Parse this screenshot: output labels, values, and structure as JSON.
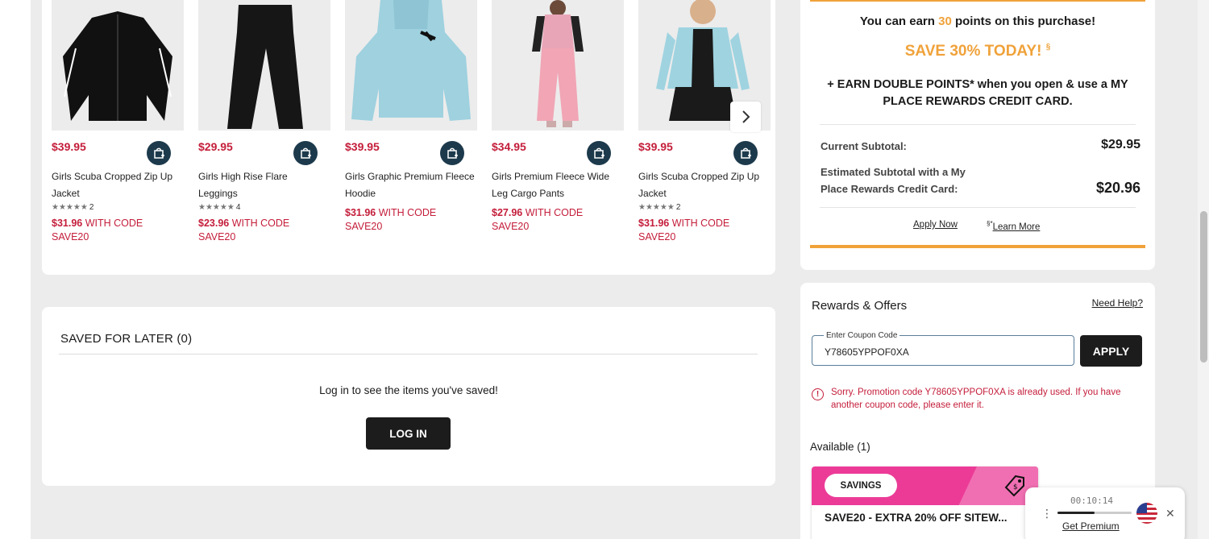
{
  "products": [
    {
      "price": "$39.95",
      "name": "Girls Scuba Cropped Zip Up Jacket",
      "rating_count": "2",
      "rating": 5,
      "promo_price": "$31.96",
      "promo_text": "WITH CODE SAVE20",
      "image": "black-jacket"
    },
    {
      "price": "$29.95",
      "name": "Girls High Rise Flare Leggings",
      "rating_count": "4",
      "rating": 5,
      "promo_price": "$23.96",
      "promo_text": "WITH CODE SAVE20",
      "image": "black-leggings"
    },
    {
      "price": "$39.95",
      "name": "Girls Graphic Premium Fleece Hoodie",
      "rating_count": "",
      "promo_price": "$31.96",
      "promo_text": "WITH CODE SAVE20",
      "image": "blue-hoodie"
    },
    {
      "price": "$34.95",
      "name": "Girls Premium Fleece Wide Leg Cargo Pants",
      "rating_count": "",
      "promo_price": "$27.96",
      "promo_text": "WITH CODE SAVE20",
      "image": "pink-cargo-pants"
    },
    {
      "price": "$39.95",
      "name": "Girls Scuba Cropped Zip Up Jacket",
      "rating_count": "2",
      "rating": 5,
      "promo_price": "$31.96",
      "promo_text": "WITH CODE SAVE20",
      "image": "blue-jacket"
    }
  ],
  "saved": {
    "title": "SAVED FOR LATER (0)",
    "message": "Log in to see the items you've saved!",
    "login_label": "LOG IN"
  },
  "summary": {
    "earn_prefix": "You can earn",
    "earn_points": "30",
    "earn_suffix": "points on this purchase!",
    "save_today": "SAVE 30% TODAY!",
    "save_mark": "§",
    "double_points": "+ EARN DOUBLE POINTS* when you open & use a MY PLACE REWARDS CREDIT CARD.",
    "current_label": "Current Subtotal:",
    "current_value": "$29.95",
    "estimated_label": "Estimated Subtotal with a My Place Rewards Credit Card:",
    "estimated_value": "$20.96",
    "apply_now": "Apply Now",
    "learn_mark": "§*",
    "learn_more": "Learn More"
  },
  "rewards": {
    "title": "Rewards & Offers",
    "need_help": "Need Help?",
    "coupon_label": "Enter Coupon Code",
    "coupon_value": "Y78605YPPOF0XA",
    "apply_label": "APPLY",
    "error_text": "Sorry. Promotion code Y78605YPPOF0XA is already used. If you have another coupon code, please enter it.",
    "available": "Available (1)",
    "offer_badge": "SAVINGS",
    "offer_text": "SAVE20 - EXTRA 20% OFF SITEW..."
  },
  "widget": {
    "timer": "00:10:14",
    "premium": "Get Premium",
    "progress": 0.5
  },
  "colors": {
    "price_red": "#c41d3a",
    "accent_orange": "#f0a23a",
    "offer_pink": "#ec3b97",
    "bag_navy": "#1d3a4c"
  }
}
